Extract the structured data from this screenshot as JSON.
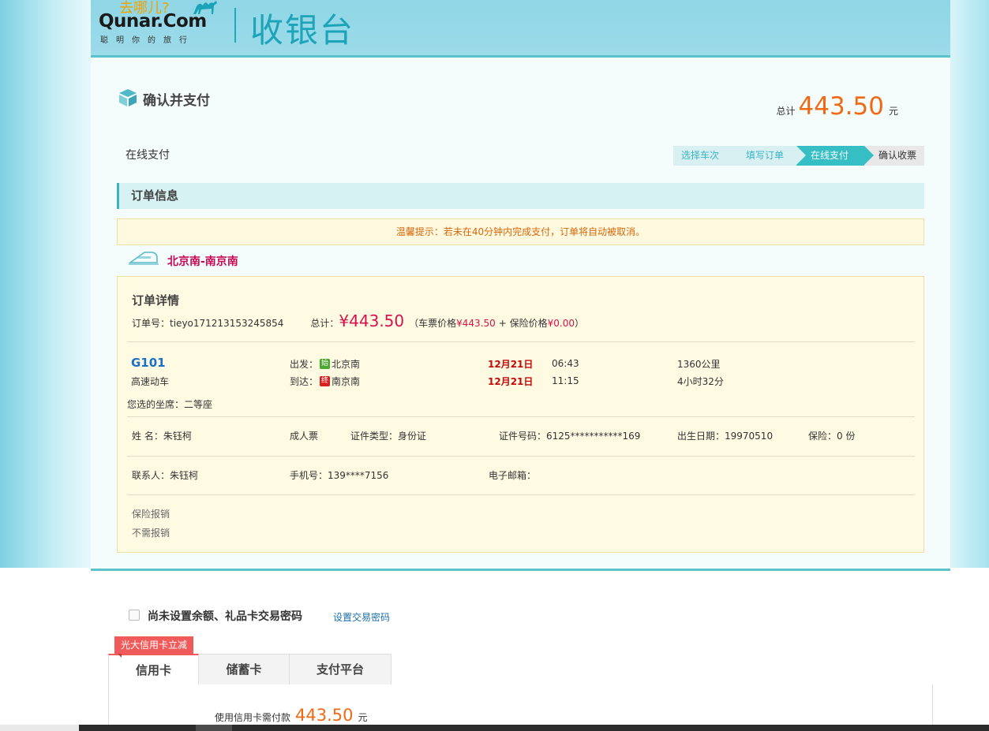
{
  "header": {
    "logo_tagline": "去哪儿?",
    "logo_name": "Qunar.Com",
    "logo_slogan": "聪明你的旅行",
    "page_title": "收银台"
  },
  "confirm": {
    "title": "确认并支付",
    "total_label": "总计",
    "total_amount": "443.50",
    "total_unit": "元",
    "online_pay": "在线支付"
  },
  "steps": [
    {
      "label": "选择车次",
      "state": "done"
    },
    {
      "label": "填写订单",
      "state": "done"
    },
    {
      "label": "在线支付",
      "state": "active"
    },
    {
      "label": "确认收票",
      "state": "pending"
    }
  ],
  "order": {
    "section_title": "订单信息",
    "notice": "温馨提示：若未在40分钟内完成支付，订单将自动被取消。",
    "route": "北京南-南京南",
    "details_title": "订单详情",
    "order_no_label": "订单号：",
    "order_no": "tieyo171213153245854",
    "total_label": "总计：",
    "total_amount": "¥443.50",
    "breakdown_open": "（车票价格",
    "ticket_price": "¥443.50",
    "plus_insurance": "+ 保险价格",
    "insurance_price": "¥0.00",
    "breakdown_close": "）"
  },
  "train": {
    "number": "G101",
    "type": "高速动车",
    "depart_label": "出发：",
    "depart_badge": "始",
    "depart_station": "北京南",
    "arrive_label": "到达：",
    "arrive_badge": "终",
    "arrive_station": "南京南",
    "depart_date": "12月21日",
    "depart_time": "06:43",
    "arrive_date": "12月21日",
    "arrive_time": "11:15",
    "distance": "1360公里",
    "duration": "4小时32分",
    "seat": "您选的坐席：二等座"
  },
  "passenger": {
    "name": "姓 名：朱钰柯",
    "ticket_type": "成人票",
    "id_type": "证件类型：身份证",
    "id_no": "证件号码：6125***********169",
    "birth": "出生日期：19970510",
    "insurance": "保险：0 份"
  },
  "contact": {
    "name": "联系人：朱钰柯",
    "phone": "手机号：139****7156",
    "email": "电子邮箱："
  },
  "reimburse": {
    "title": "保险报销",
    "value": "不需报销"
  },
  "payment": {
    "password_text": "尚未设置余额、礼品卡交易密码",
    "password_link": "设置交易密码",
    "promo": "光大信用卡立减",
    "tabs": [
      "信用卡",
      "储蓄卡",
      "支付平台"
    ],
    "pay_label": "使用信用卡需付款",
    "pay_amount": "443.50",
    "pay_unit": "元"
  },
  "colors": {
    "accent": "#35bfc4",
    "price_orange": "#f06a16",
    "price_red": "#d8114c",
    "route_red": "#c40a56",
    "link_blue": "#1a6fa8"
  }
}
